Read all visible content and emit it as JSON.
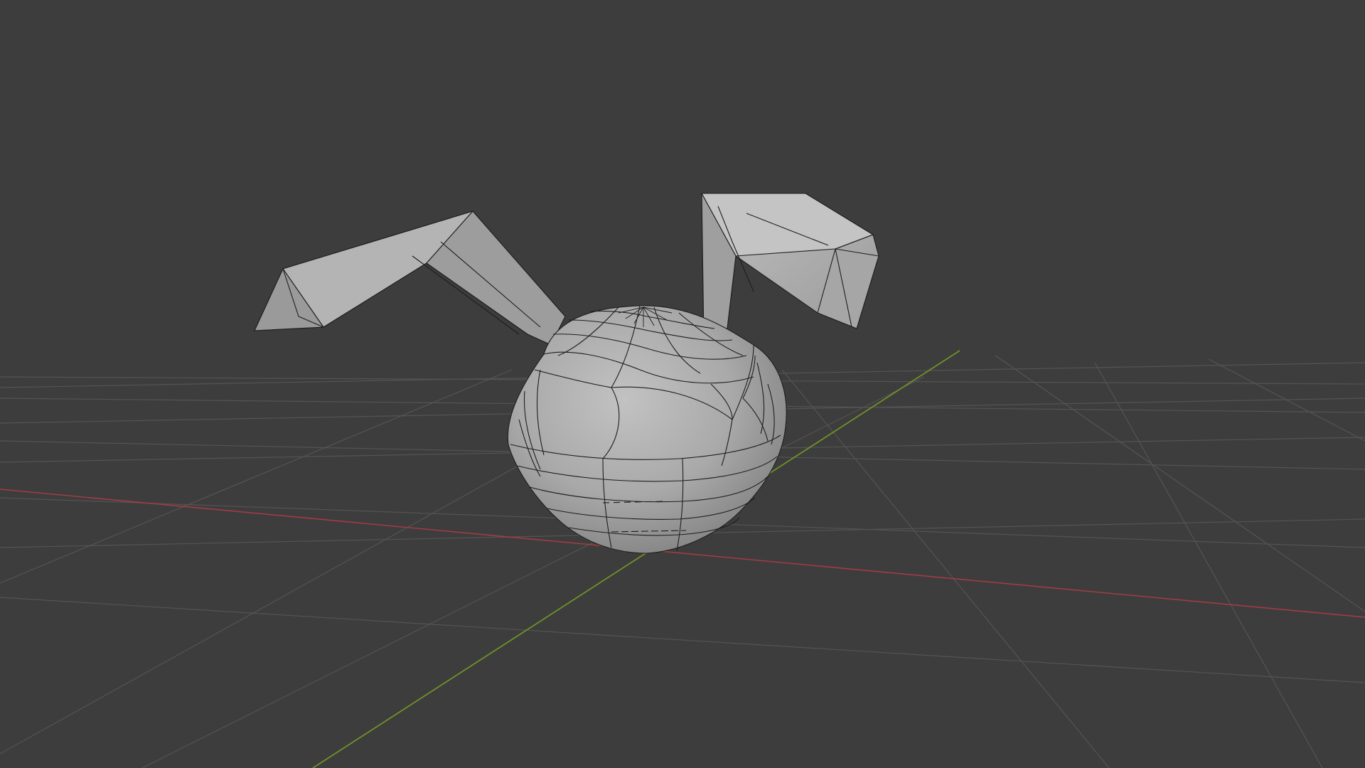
{
  "viewport": {
    "background_color": "#3d3d3d",
    "shading": "solid",
    "overlay": "wireframe",
    "grid_color": "#545454",
    "x_axis_color": "#a33b45",
    "y_axis_color": "#6f9127"
  },
  "object": {
    "description_icon": "mesh-object",
    "base_color": "#a8a8a8",
    "wire_color": "#1e1e1e"
  }
}
